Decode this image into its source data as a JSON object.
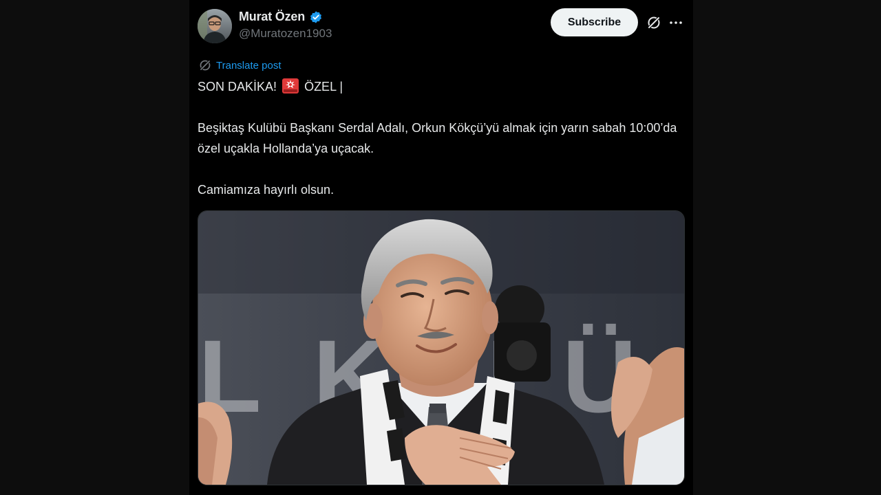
{
  "author": {
    "display_name": "Murat Özen",
    "handle": "@Muratozen1903",
    "verified": true,
    "avatar_icon": "user-avatar"
  },
  "actions": {
    "subscribe_label": "Subscribe",
    "grok_icon": "grok-icon",
    "more_icon": "more-icon"
  },
  "translate": {
    "label": "Translate post",
    "icon": "translate-icon"
  },
  "post": {
    "line1_before": "SON DAKİKA!",
    "line1_after": "ÖZEL |",
    "paragraph2": "Beşiktaş Kulübü Başkanı Serdal Adalı, Orkun Kökçü’yü almak için yarın sabah 10:00’da  özel uçakla Hollanda’ya uçacak.",
    "paragraph3": "Camiamıza hayırlı olsun."
  },
  "media": {
    "background_text": "L KULÜ"
  },
  "colors": {
    "background": "#000000",
    "text_primary": "#e7e9ea",
    "text_secondary": "#71767b",
    "accent": "#1d9bf0",
    "verified_badge": "#1d9bf0",
    "subscribe_bg": "#eff3f4"
  }
}
